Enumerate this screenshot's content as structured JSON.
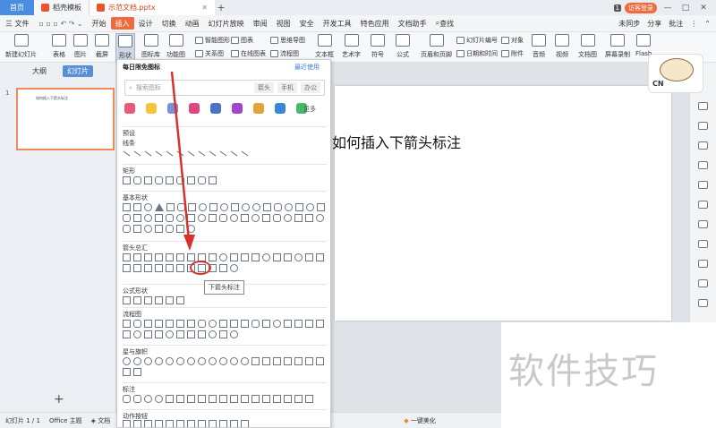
{
  "titlebar": {
    "tabs": [
      {
        "label": "首页"
      },
      {
        "label": "稻壳模板"
      },
      {
        "label": "示范文档.pptx"
      }
    ],
    "page_badge": "1",
    "login_label": "访客登录"
  },
  "menubar": {
    "file_label": "三 文件",
    "items": [
      "开始",
      "插入",
      "设计",
      "切换",
      "动画",
      "幻灯片放映",
      "审阅",
      "视图",
      "安全",
      "开发工具",
      "特色应用",
      "文档助手"
    ],
    "active": "插入",
    "search_label": "查找",
    "sync_label": "未同步",
    "share_label": "分享",
    "comment_label": "批注"
  },
  "ribbon": {
    "big": [
      "新建幻灯片",
      "表格",
      "图片",
      "截屏",
      "形状",
      "图标库",
      "功能图"
    ],
    "small1": [
      "智能图形",
      "关系图"
    ],
    "small2": [
      "图表",
      "在线图表"
    ],
    "small3": [
      "思维导图",
      "流程图"
    ],
    "text_tools": [
      "文本框",
      "艺术字",
      "符号",
      "公式"
    ],
    "big2": [
      "页眉和页脚"
    ],
    "small4": [
      "幻灯片编号",
      "日期和时间"
    ],
    "small5": [
      "对象",
      "附件"
    ],
    "media": [
      "音频",
      "视频",
      "文档图",
      "屏幕录制",
      "Flash"
    ]
  },
  "leftpane": {
    "tabs": [
      "大纲",
      "幻灯片"
    ],
    "active_tab": "幻灯片",
    "slide_number": "1",
    "thumb_text": "如何插入下箭头标注"
  },
  "slide": {
    "title": "如何插入下箭头标注"
  },
  "shape_panel": {
    "header": "每日限免图标",
    "recent": "最近使用",
    "search_placeholder": "搜索图标",
    "search_tags": [
      "箭头",
      "手机",
      "办公"
    ],
    "more": "更多",
    "sections": [
      "预设",
      "线条",
      "矩形",
      "基本形状",
      "箭头总汇",
      "公式形状",
      "流程图",
      "星与旗帜",
      "标注",
      "动作按钮"
    ],
    "tooltip": "下箭头标注"
  },
  "mascot": {
    "label": "CN"
  },
  "status": {
    "slide_info": "幻灯片 1 / 1",
    "theme": "Office 主题",
    "doc_protect": "文档",
    "beautify": "一键美化"
  },
  "watermark": "软件技巧",
  "colors": {
    "accent": "#ef6a3d",
    "highlight": "#d9312b",
    "home_tab": "#4a8de0"
  }
}
